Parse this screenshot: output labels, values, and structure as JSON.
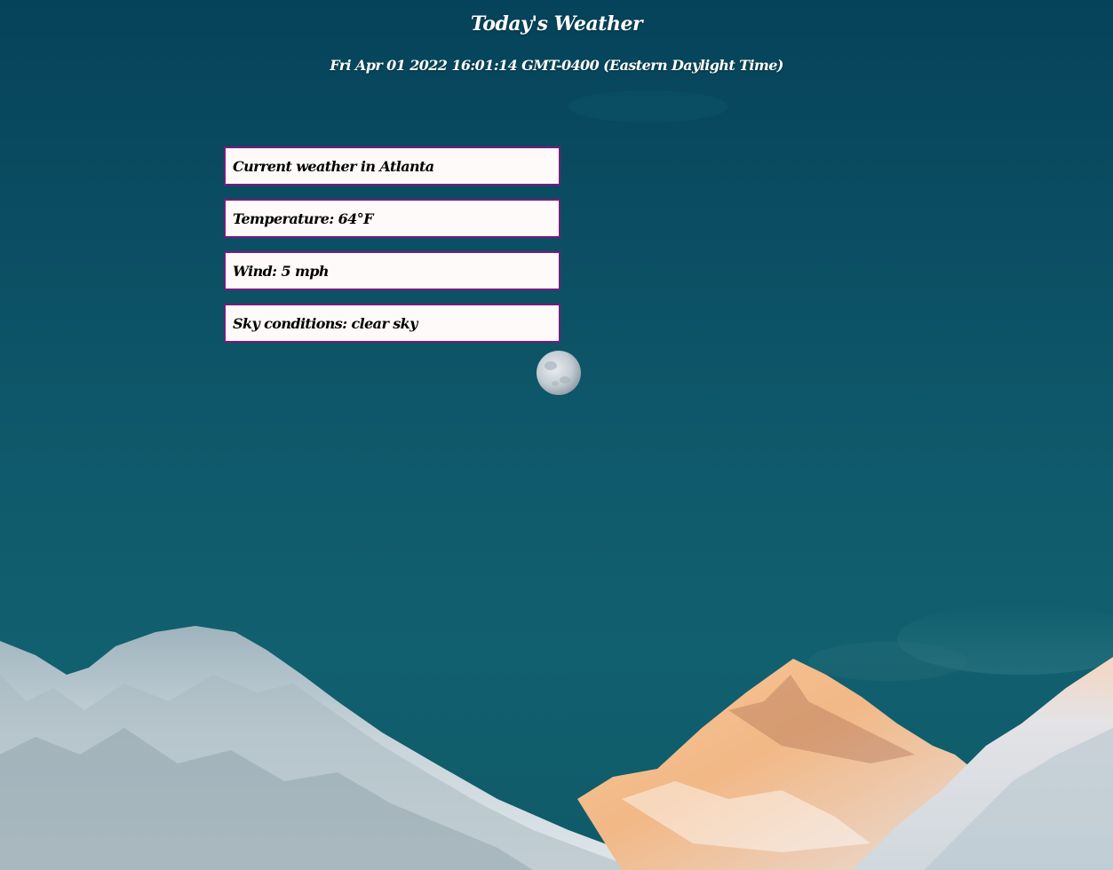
{
  "header": {
    "title": "Today's Weather",
    "datetime": "Fri Apr 01 2022 16:01:14 GMT-0400 (Eastern Daylight Time)"
  },
  "weather": {
    "location": "Current weather in Atlanta",
    "temperature": "Temperature: 64°F",
    "wind": "Wind: 5 mph",
    "sky": "Sky conditions: clear sky"
  },
  "colors": {
    "sky_top": "#05435a",
    "sky_bottom": "#11606f",
    "card_background": "#fffafa",
    "card_border": "#7a1a7e",
    "header_text": "#ffffff"
  }
}
